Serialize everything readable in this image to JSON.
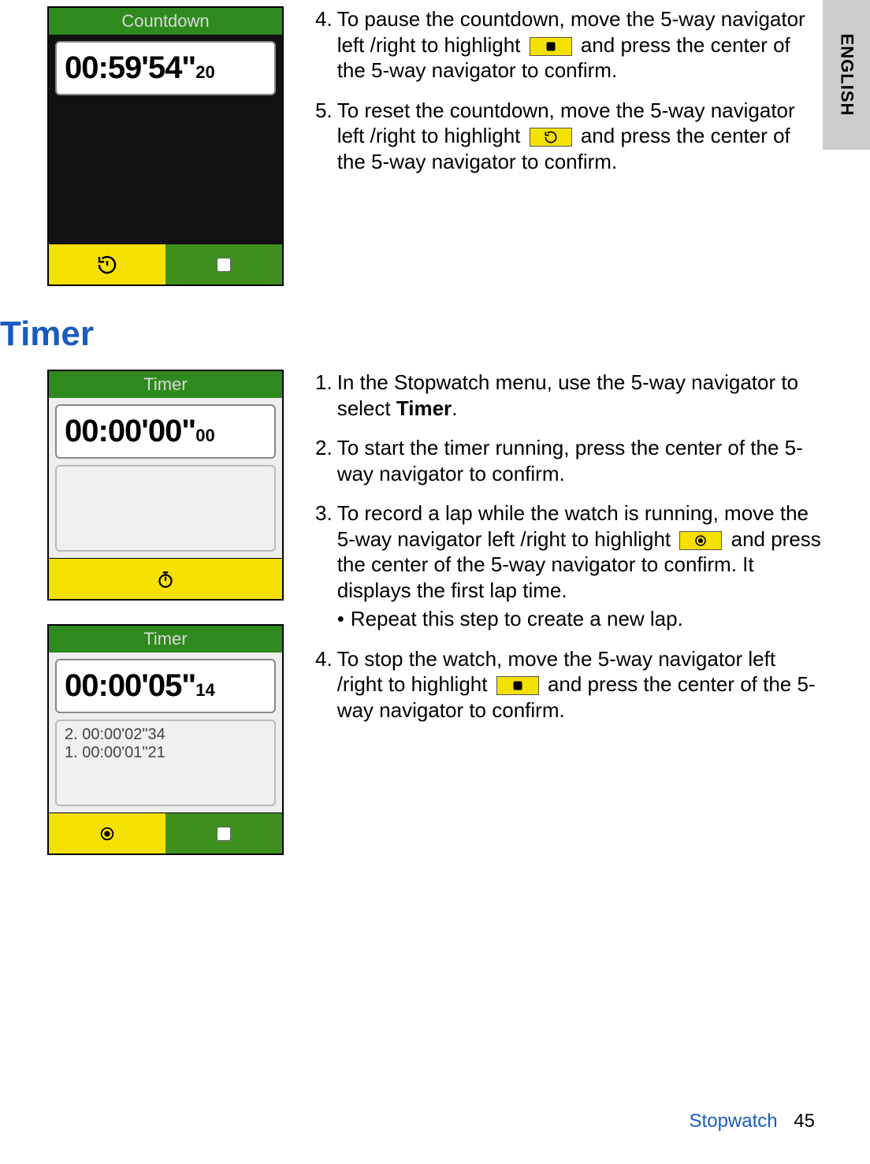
{
  "sideTab": "ENGLISH",
  "sectionTitle": "Timer",
  "footer": {
    "chapter": "Stopwatch",
    "page": "45"
  },
  "devices": {
    "countdown": {
      "title": "Countdown",
      "timeMain": "00:59'54\"",
      "timeSub": "20"
    },
    "timer1": {
      "title": "Timer",
      "timeMain": "00:00'00\"",
      "timeSub": "00"
    },
    "timer2": {
      "title": "Timer",
      "timeMain": "00:00'05\"",
      "timeSub": "14",
      "laps": [
        "2. 00:00'02\"34",
        "1. 00:00'01\"21"
      ]
    }
  },
  "countdownSteps": {
    "s4": {
      "num": "4.",
      "pre": "To pause the countdown, move the 5-way navigator left /right to highlight ",
      "post": " and press the center of the 5-way navigator to confirm."
    },
    "s5": {
      "num": "5.",
      "pre": "To reset the countdown, move the 5-way navigator left /right to highlight ",
      "post": " and press the center of the 5-way navigator to confirm."
    }
  },
  "timerSteps": {
    "s1": {
      "num": "1.",
      "pre": "In the Stopwatch menu, use the 5-way navigator to select ",
      "bold": "Timer",
      "post": "."
    },
    "s2": {
      "num": "2.",
      "text": "To start the timer running, press the center of the 5-way navigator to confirm."
    },
    "s3": {
      "num": "3.",
      "pre": "To record a lap while the watch is running, move the 5-way navigator left /right to highlight ",
      "post": " and press the center of the 5-way navigator to confirm. It displays the first lap time.",
      "bullet": "Repeat this step to create a new lap."
    },
    "s4": {
      "num": "4.",
      "pre": "To stop the watch, move the 5-way navigator left /right to highlight ",
      "post": " and press the center of the 5-way navigator to confirm."
    }
  }
}
